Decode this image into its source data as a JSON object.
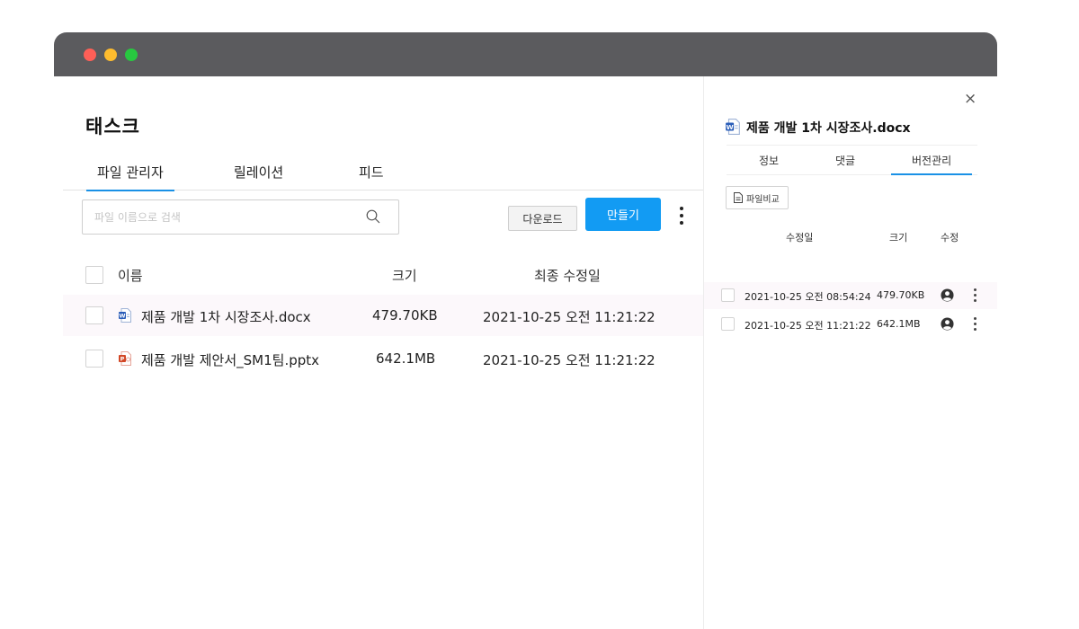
{
  "window": {
    "controls": [
      "close",
      "minimize",
      "maximize"
    ]
  },
  "main": {
    "title": "태스크",
    "tabs": [
      {
        "label": "파일 관리자",
        "active": true
      },
      {
        "label": "릴레이션",
        "active": false
      },
      {
        "label": "피드",
        "active": false
      }
    ],
    "search": {
      "placeholder": "파일 이름으로 검색",
      "value": "",
      "icon": "search-icon"
    },
    "download_label": "다운로드",
    "create_label": "만들기",
    "columns": {
      "name": "이름",
      "size": "크기",
      "modified": "최종 수정일"
    },
    "files": [
      {
        "name": "제품 개발 1차 시장조사.docx",
        "size": "479.70KB",
        "modified": "2021-10-25 오전 11:21:22",
        "icon": "word-file-icon",
        "selected": true
      },
      {
        "name": "제품 개발 제안서_SM1팀.pptx",
        "size": "642.1MB",
        "modified": "2021-10-25 오전 11:21:22",
        "icon": "powerpoint-file-icon",
        "selected": false
      }
    ]
  },
  "panel": {
    "file_title": "제품 개발 1차 시장조사.docx",
    "tabs": [
      {
        "label": "정보",
        "active": false
      },
      {
        "label": "댓글",
        "active": false
      },
      {
        "label": "버전관리",
        "active": true
      }
    ],
    "compare_label": "파일비교",
    "columns": {
      "modified": "수정일",
      "size": "크기",
      "editor": "수정"
    },
    "versions": [
      {
        "modified": "2021-10-25 오전 08:54:24",
        "size": "479.70KB",
        "selected": true
      },
      {
        "modified": "2021-10-25 오전 11:21:22",
        "size": "642.1MB",
        "selected": false
      }
    ]
  },
  "colors": {
    "titlebar": "#5b5b5e",
    "accent": "#129bf3",
    "tab_underline": "#1a91e6",
    "selected_row": "#fcf8fb"
  }
}
